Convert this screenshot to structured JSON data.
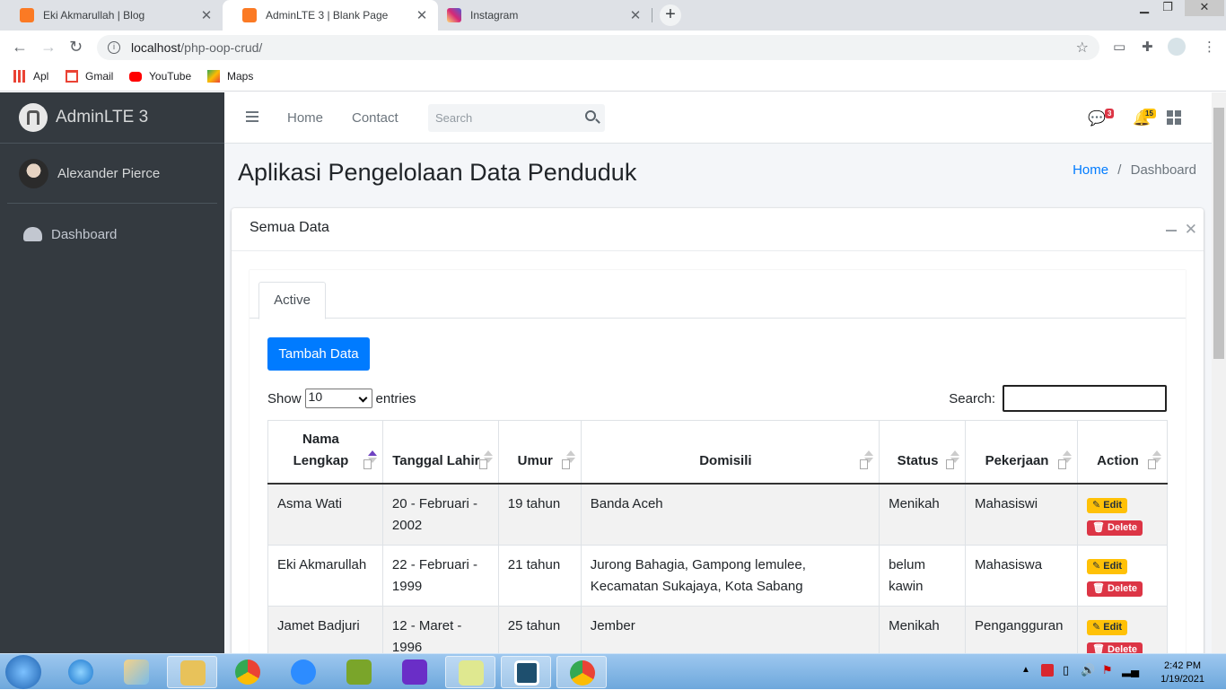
{
  "browser": {
    "tabs": [
      {
        "title": "Eki Akmarullah | Blog",
        "favicon": "xampp-icon",
        "color": "#fb7a24"
      },
      {
        "title": "AdminLTE 3 | Blank Page",
        "favicon": "xampp-icon",
        "color": "#fb7a24"
      },
      {
        "title": "Instagram",
        "favicon": "instagram-icon",
        "color": "#d62976"
      }
    ],
    "new_tab": "+",
    "url_host": "localhost",
    "url_path": "/php-oop-crud/",
    "bookmarks": [
      "Apl",
      "Gmail",
      "YouTube",
      "Maps"
    ]
  },
  "sidebar": {
    "brand": "AdminLTE 3",
    "user": "Alexander Pierce",
    "menu": [
      {
        "label": "Dashboard",
        "icon": "tachometer-icon"
      }
    ]
  },
  "topnav": {
    "links": [
      "Home",
      "Contact"
    ],
    "search_placeholder": "Search",
    "messages_count": "3",
    "notifications_count": "15"
  },
  "page": {
    "title": "Aplikasi Pengelolaan Data Penduduk",
    "breadcrumb_home": "Home",
    "breadcrumb_sep": "/",
    "breadcrumb_current": "Dashboard"
  },
  "card": {
    "title": "Semua Data",
    "tab": "Active",
    "add_button": "Tambah Data",
    "show_label": "Show",
    "entries_value": "10",
    "entries_label": "entries",
    "search_label": "Search:"
  },
  "table": {
    "headers": [
      "Nama Lengkap",
      "Tanggal Lahir",
      "Umur",
      "Domisili",
      "Status",
      "Pekerjaan",
      "Action"
    ],
    "rows": [
      [
        "Asma Wati",
        "20 - Februari - 2002",
        "19 tahun",
        "Banda Aceh",
        "Menikah",
        "Mahasiswi"
      ],
      [
        "Eki Akmarullah",
        "22 - Februari - 1999",
        "21 tahun",
        "Jurong Bahagia, Gampong lemulee, Kecamatan Sukajaya, Kota Sabang",
        "belum kawin",
        "Mahasiswa"
      ],
      [
        "Jamet Badjuri",
        "12 - Maret - 1996",
        "25 tahun",
        "Jember",
        "Menikah",
        "Pengangguran"
      ]
    ],
    "edit_label": "Edit",
    "delete_label": "Delete"
  },
  "taskbar": {
    "time": "2:42 PM",
    "date": "1/19/2021"
  }
}
